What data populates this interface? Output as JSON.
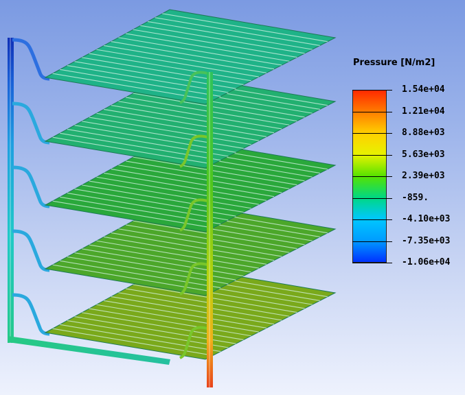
{
  "legend": {
    "title": "Pressure [N/m2]",
    "labels": [
      "1.54e+04",
      "1.21e+04",
      "8.88e+03",
      "5.63e+03",
      "2.39e+03",
      "-859.",
      "-4.10e+03",
      "-7.35e+03",
      "-1.06e+04"
    ]
  },
  "model": {
    "plate_count": 5,
    "colors": {
      "plate_top": "#1fb388",
      "plate_2": "#22b070",
      "plate_3": "#2aa83b",
      "plate_4": "#4ca72a",
      "plate_5": "#7aa91b",
      "outlet_top": "#1733c8",
      "inlet_bottom": "#e24b18"
    }
  }
}
